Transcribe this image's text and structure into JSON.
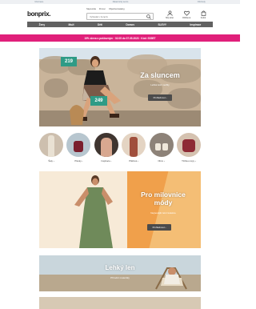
{
  "top_strip": [
    "Informace",
    "Zákaznický servis",
    "Obchody"
  ],
  "header": {
    "logo": "bonprix.",
    "links": [
      "Nápověda",
      "Pomoc",
      "Objednat katalog"
    ],
    "search_placeholder": "Vyhledat v bonprix",
    "account_label": "Můj účet",
    "wishlist_label": "Oblíbené",
    "cart_label": "Košík"
  },
  "nav": [
    "Ženy",
    "Muži",
    "Děti",
    "Domov",
    "SLEVY",
    "Inspirace"
  ],
  "promo": "15% sleva s poštovným · 02.05 do 07.05.2023 · Kód: SS5ET",
  "hero1": {
    "price_1": "219",
    "price_2": "249",
    "title": "Za sluncem",
    "subtitle": "Lehké letní outfity",
    "button": "Prohlédnout ›"
  },
  "categories": [
    "Šaty ›",
    "Plavky ›",
    "Inspirace ›",
    "Plážové ›",
    "Obuv ›",
    "Trička a topy ›"
  ],
  "hero2": {
    "title_line1": "Pro milovnice",
    "title_line2": "módy",
    "subtitle": "Nejnovější letní kolekce",
    "button": "Prohlédnout ›"
  },
  "hero3": {
    "title": "Lehký len",
    "subtitle": "Přírodní materiály"
  },
  "colors": {
    "promo": "#e0207a",
    "price_tag": "#2f9b86",
    "nav": "#616161"
  }
}
